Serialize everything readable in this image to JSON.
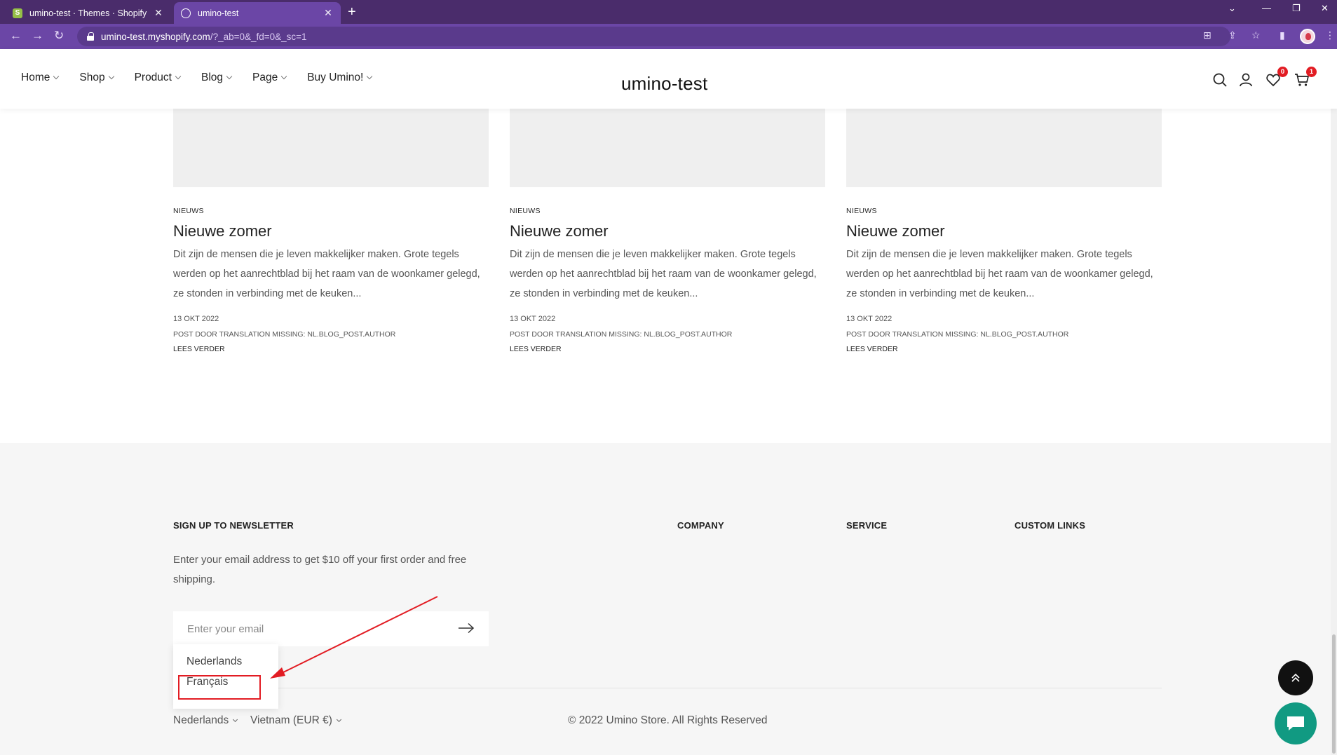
{
  "browser": {
    "tabs": [
      {
        "title": "umino-test · Themes · Shopify",
        "favicon": "shopify-icon"
      },
      {
        "title": "umino-test",
        "favicon": "globe-icon",
        "active": true
      }
    ],
    "url_host": "umino-test.myshopify.com",
    "url_path": "/?_ab=0&_fd=0&_sc=1",
    "accent": "#6b46a6"
  },
  "header": {
    "logo": "umino-test",
    "nav": [
      "Home",
      "Shop",
      "Product",
      "Blog",
      "Page",
      "Buy Umino!"
    ],
    "wishlist_count": "0",
    "cart_count": "1",
    "badge_color": "#e21c23"
  },
  "posts": [
    {
      "tag": "NIEUWS",
      "title": "Nieuwe zomer",
      "excerpt": "Dit zijn de mensen die je leven makkelijker maken. Grote tegels werden op het aanrechtblad bij het raam van de woonkamer gelegd, ze stonden in verbinding met de keuken...",
      "date": "13 OKT 2022",
      "author": "POST DOOR TRANSLATION MISSING: NL.BLOG_POST.AUTHOR",
      "read_more": "LEES VERDER"
    },
    {
      "tag": "NIEUWS",
      "title": "Nieuwe zomer",
      "excerpt": "Dit zijn de mensen die je leven makkelijker maken. Grote tegels werden op het aanrechtblad bij het raam van de woonkamer gelegd, ze stonden in verbinding met de keuken...",
      "date": "13 OKT 2022",
      "author": "POST DOOR TRANSLATION MISSING: NL.BLOG_POST.AUTHOR",
      "read_more": "LEES VERDER"
    },
    {
      "tag": "NIEUWS",
      "title": "Nieuwe zomer",
      "excerpt": "Dit zijn de mensen die je leven makkelijker maken. Grote tegels werden op het aanrechtblad bij het raam van de woonkamer gelegd, ze stonden in verbinding met de keuken...",
      "date": "13 OKT 2022",
      "author": "POST DOOR TRANSLATION MISSING: NL.BLOG_POST.AUTHOR",
      "read_more": "LEES VERDER"
    }
  ],
  "footer": {
    "newsletter_heading": "SIGN UP TO NEWSLETTER",
    "newsletter_text": "Enter your email address to get $10 off your first order and free shipping.",
    "email_placeholder": "Enter your email",
    "columns": [
      "COMPANY",
      "SERVICE",
      "CUSTOM LINKS"
    ],
    "language": "Nederlands",
    "currency": "Vietnam (EUR €)",
    "copyright": "© 2022 Umino Store. All Rights Reserved",
    "language_options": [
      "Nederlands",
      "Français"
    ],
    "highlight_color": "#e21c23",
    "chat_color": "#119a82"
  }
}
